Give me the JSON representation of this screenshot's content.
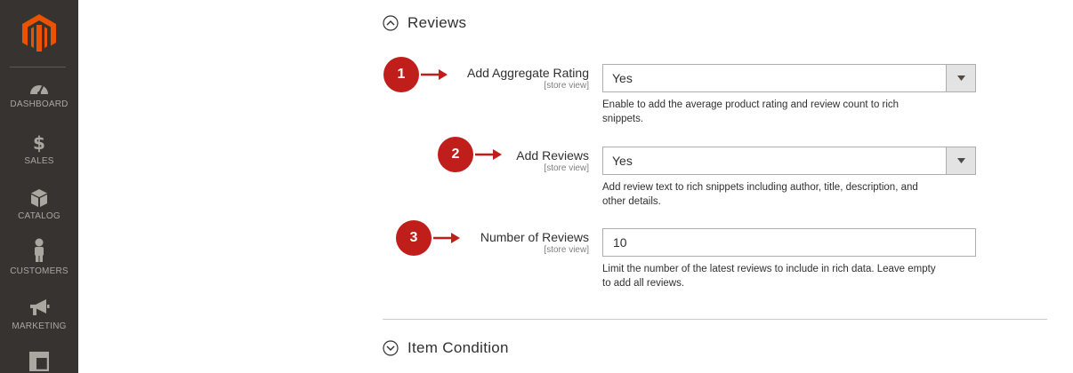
{
  "sidebar": {
    "items": [
      {
        "label": "DASHBOARD",
        "icon": "dashboard-gauge-icon"
      },
      {
        "label": "SALES",
        "icon": "dollar-icon"
      },
      {
        "label": "CATALOG",
        "icon": "box-icon"
      },
      {
        "label": "CUSTOMERS",
        "icon": "person-icon"
      },
      {
        "label": "MARKETING",
        "icon": "megaphone-icon"
      },
      {
        "label": "",
        "icon": "layout-icon"
      }
    ]
  },
  "sections": {
    "reviews": {
      "title": "Reviews",
      "state": "expanded"
    },
    "item_condition": {
      "title": "Item Condition",
      "state": "collapsed"
    }
  },
  "fields": [
    {
      "marker": "1",
      "label": "Add Aggregate Rating",
      "scope": "[store view]",
      "type": "select",
      "value": "Yes",
      "note_line1": "Enable to add the average product rating and review count to rich",
      "note_line2": "snippets."
    },
    {
      "marker": "2",
      "label": "Add Reviews",
      "scope": "[store view]",
      "type": "select",
      "value": "Yes",
      "note_line1": "Add review text to rich snippets including author, title, description, and",
      "note_line2": "other details."
    },
    {
      "marker": "3",
      "label": "Number of Reviews",
      "scope": "[store view]",
      "type": "text",
      "value": "10",
      "note_line1": "Limit the number of the latest reviews to include in rich data. Leave empty",
      "note_line2": "to add all reviews."
    }
  ],
  "colors": {
    "sidebar_bg": "#373330",
    "brand_orange": "#eb5202",
    "marker_red": "#c01e1b"
  }
}
